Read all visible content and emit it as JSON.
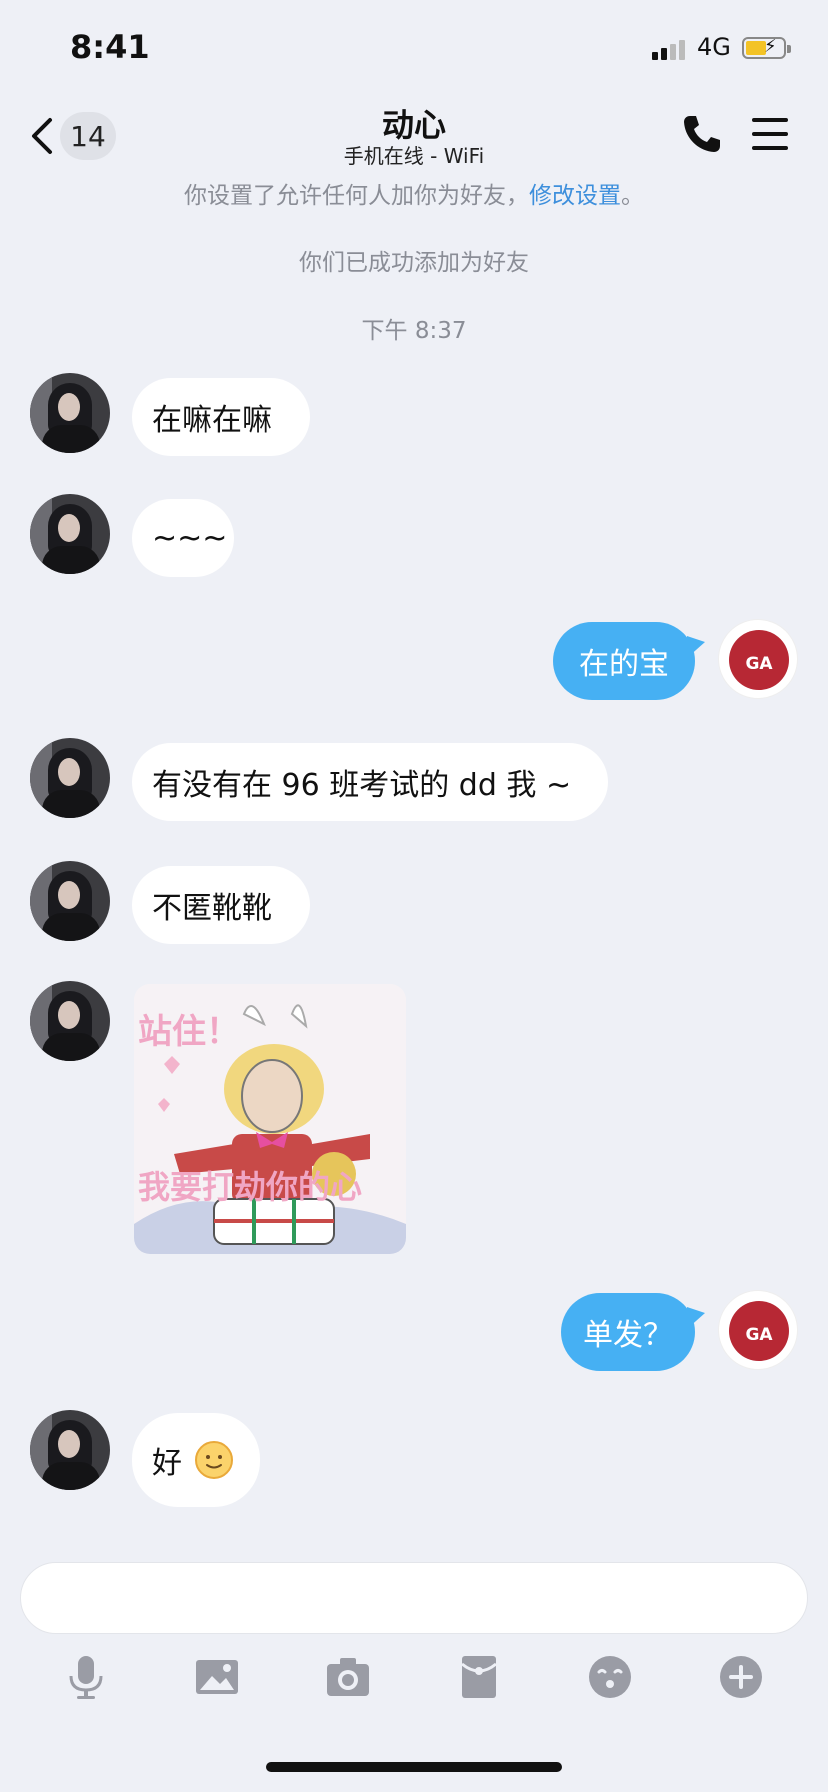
{
  "status_bar": {
    "time": "8:41",
    "network": "4G"
  },
  "header": {
    "unread_count": "14",
    "title": "动心",
    "subtitle": "手机在线 - WiFi"
  },
  "notices": {
    "permission_text": "你设置了允许任何人加你为好友，",
    "permission_link": "修改设置",
    "permission_end": "。",
    "added_text": "你们已成功添加为好友",
    "timestamp": "下午 8:37"
  },
  "messages": [
    {
      "from": "them",
      "text": "在嘛在嘛"
    },
    {
      "from": "them",
      "text": "~~~"
    },
    {
      "from": "me",
      "text": "在的宝"
    },
    {
      "from": "them",
      "text": "有没有在 96 班考试的 dd 我 ~"
    },
    {
      "from": "them",
      "text": "不匿靴靴"
    },
    {
      "from": "them",
      "sticker": {
        "top_text": "站住！",
        "bottom_text": "我要打劫你的心"
      }
    },
    {
      "from": "me",
      "text": "单发？"
    },
    {
      "from": "them",
      "text": "好",
      "emoji": "smiley-emoji"
    }
  ],
  "my_avatar_logo": "GA",
  "toolbar": [
    "microphone-icon",
    "image-icon",
    "camera-icon",
    "red-packet-icon",
    "emoji-icon",
    "plus-icon"
  ],
  "colors": {
    "background": "#eef0f6",
    "outgoing_bubble": "#46b0f3",
    "incoming_bubble": "#ffffff",
    "link": "#3d8fdc"
  }
}
